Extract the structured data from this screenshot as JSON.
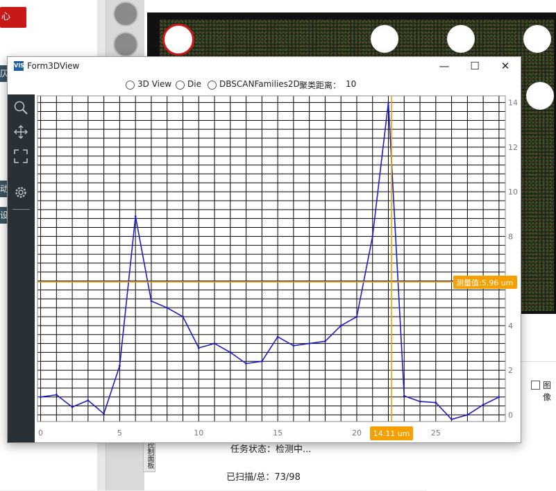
{
  "background": {
    "red_button_label": "心",
    "side_fragments": [
      "仄",
      "动",
      "设"
    ],
    "status_text": "任务状态：检测中...",
    "scanned_text": "已扫描/总：73/98",
    "checkbox_label": "图像",
    "side_tab_label": "控制面板"
  },
  "window": {
    "title": "Form3DView",
    "app_icon": "VIS",
    "minimize": "—",
    "maximize": "☐",
    "close": "✕"
  },
  "options": {
    "radio_3d": "3D View",
    "radio_die": "Die",
    "radio_dbscan": "DBSCANFamilies2D",
    "cluster_label": "聚类距离：",
    "cluster_value": "10"
  },
  "toolbar": {
    "icons": [
      "zoom-icon",
      "move-icon",
      "fit-icon",
      "settings-icon"
    ]
  },
  "chart_data": {
    "type": "line",
    "x": [
      0,
      1,
      2,
      3,
      4,
      5,
      6,
      7,
      8,
      9,
      10,
      11,
      12,
      13,
      14,
      15,
      16,
      17,
      18,
      19,
      20,
      21,
      22,
      23,
      24,
      25,
      26,
      27,
      28,
      29
    ],
    "series": [
      {
        "values": [
          0.8,
          0.9,
          0.35,
          0.65,
          0.05,
          2.2,
          8.9,
          5.1,
          4.8,
          4.4,
          3.0,
          3.2,
          2.8,
          2.3,
          2.4,
          3.5,
          3.1,
          3.2,
          3.3,
          4.0,
          4.4,
          8.0,
          14.0,
          0.85,
          0.6,
          0.55,
          -0.2,
          0.0,
          0.45,
          0.8
        ],
        "color": "#1c1cc8"
      }
    ],
    "xticks": [
      0,
      5,
      10,
      15,
      20,
      25
    ],
    "yticks": [
      0,
      2,
      4,
      6,
      8,
      10,
      12,
      14
    ],
    "xlim": [
      -0.2,
      29.4
    ],
    "ylim": [
      -0.3,
      14.3
    ],
    "grid": true,
    "cursor": {
      "x": 22.2,
      "y": 5.96,
      "x_label": "14.11 um",
      "y_label": "测量值:5.96 um",
      "color": "#f5a000"
    }
  }
}
